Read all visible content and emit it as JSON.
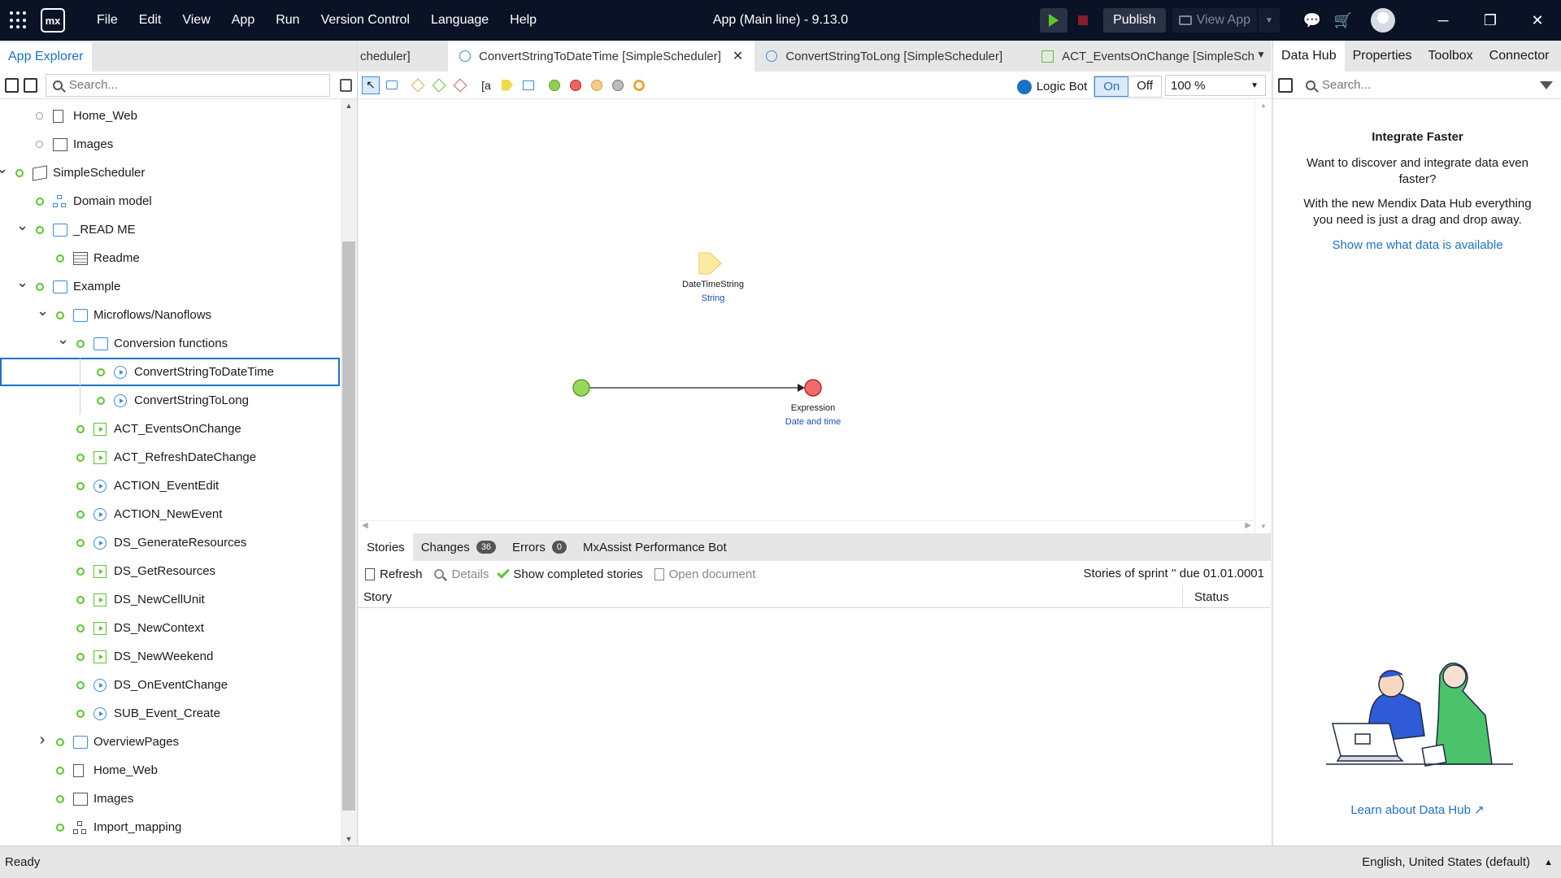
{
  "titlebar": {
    "menu": [
      "File",
      "Edit",
      "View",
      "App",
      "Run",
      "Version Control",
      "Language",
      "Help"
    ],
    "app_title": "App (Main line)  -  9.13.0",
    "publish": "Publish",
    "view_app": "View App",
    "logo": "mx"
  },
  "left_panel": {
    "tab": "App Explorer",
    "search_placeholder": "Search...",
    "tree": [
      {
        "label": "Home_Web",
        "icon": "page-icon",
        "depth": 2,
        "status": "grey"
      },
      {
        "label": "Images",
        "icon": "images-icon",
        "depth": 2,
        "status": "grey"
      },
      {
        "label": "SimpleScheduler",
        "icon": "module-icon",
        "depth": 1,
        "status": "green",
        "chevron": "down"
      },
      {
        "label": "Domain model",
        "icon": "domain-model-icon",
        "depth": 2,
        "status": "green"
      },
      {
        "label": "_READ ME",
        "icon": "folder-icon",
        "depth": 2,
        "status": "green",
        "chevron": "down"
      },
      {
        "label": "Readme",
        "icon": "readme-icon",
        "depth": 3,
        "status": "green"
      },
      {
        "label": "Example",
        "icon": "folder-icon",
        "depth": 2,
        "status": "green",
        "chevron": "down"
      },
      {
        "label": "Microflows/Nanoflows",
        "icon": "folder-icon",
        "depth": 3,
        "status": "green",
        "chevron": "down"
      },
      {
        "label": "Conversion functions",
        "icon": "folder-icon",
        "depth": 4,
        "status": "green",
        "chevron": "down"
      },
      {
        "label": "ConvertStringToDateTime",
        "icon": "microflow-icon",
        "depth": 5,
        "status": "green",
        "selected": true
      },
      {
        "label": "ConvertStringToLong",
        "icon": "microflow-icon",
        "depth": 5,
        "status": "green"
      },
      {
        "label": "ACT_EventsOnChange",
        "icon": "nanoflow-icon",
        "depth": 4,
        "status": "green"
      },
      {
        "label": "ACT_RefreshDateChange",
        "icon": "nanoflow-icon",
        "depth": 4,
        "status": "green"
      },
      {
        "label": "ACTION_EventEdit",
        "icon": "microflow-icon",
        "depth": 4,
        "status": "green"
      },
      {
        "label": "ACTION_NewEvent",
        "icon": "microflow-icon",
        "depth": 4,
        "status": "green"
      },
      {
        "label": "DS_GenerateResources",
        "icon": "microflow-icon",
        "depth": 4,
        "status": "green"
      },
      {
        "label": "DS_GetResources",
        "icon": "nanoflow-icon",
        "depth": 4,
        "status": "green"
      },
      {
        "label": "DS_NewCellUnit",
        "icon": "nanoflow-icon",
        "depth": 4,
        "status": "green"
      },
      {
        "label": "DS_NewContext",
        "icon": "nanoflow-icon",
        "depth": 4,
        "status": "green"
      },
      {
        "label": "DS_NewWeekend",
        "icon": "nanoflow-icon",
        "depth": 4,
        "status": "green"
      },
      {
        "label": "DS_OnEventChange",
        "icon": "microflow-icon",
        "depth": 4,
        "status": "green"
      },
      {
        "label": "SUB_Event_Create",
        "icon": "microflow-icon",
        "depth": 4,
        "status": "green"
      },
      {
        "label": "OverviewPages",
        "icon": "folder-icon",
        "depth": 3,
        "status": "green",
        "chevron": "right"
      },
      {
        "label": "Home_Web",
        "icon": "page-icon",
        "depth": 3,
        "status": "green"
      },
      {
        "label": "Images",
        "icon": "images-icon",
        "depth": 3,
        "status": "green"
      },
      {
        "label": "Import_mapping",
        "icon": "import-mapping-icon",
        "depth": 3,
        "status": "green"
      }
    ]
  },
  "doc_tabs": [
    {
      "label": "cheduler]",
      "icon": "none",
      "active": false
    },
    {
      "label": "ConvertStringToDateTime [SimpleScheduler]",
      "icon": "microflow-icon",
      "active": true
    },
    {
      "label": "ConvertStringToLong [SimpleScheduler]",
      "icon": "microflow-icon",
      "active": false
    },
    {
      "label": "ACT_EventsOnChange [SimpleSch",
      "icon": "nanoflow-icon",
      "active": false
    }
  ],
  "editor": {
    "logic_bot": "Logic Bot",
    "on": "On",
    "off": "Off",
    "zoom": "100 %"
  },
  "canvas": {
    "param_name": "DateTimeString",
    "param_type": "String",
    "end_label": "Expression",
    "end_type": "Date and time"
  },
  "bottom": {
    "tabs": [
      {
        "label": "Stories",
        "badge": null,
        "active": true
      },
      {
        "label": "Changes",
        "badge": "36",
        "active": false
      },
      {
        "label": "Errors",
        "badge": "0",
        "active": false
      },
      {
        "label": "MxAssist Performance Bot",
        "badge": null,
        "active": false
      }
    ],
    "refresh": "Refresh",
    "details": "Details",
    "show_completed": "Show completed stories",
    "open_document": "Open document",
    "sprint": "Stories of sprint '' due 01.01.0001",
    "col_story": "Story",
    "col_status": "Status"
  },
  "right_panel": {
    "tabs": [
      "Data Hub",
      "Properties",
      "Toolbox",
      "Connector"
    ],
    "search_placeholder": "Search...",
    "title": "Integrate Faster",
    "p1": "Want to discover and integrate data even faster?",
    "p2": "With the new Mendix Data Hub everything you need is just a drag and drop away.",
    "link": "Show me what data is available",
    "learn": "Learn about Data Hub"
  },
  "statusbar": {
    "status": "Ready",
    "language": "English, United States (default)"
  },
  "colors": {
    "accent": "#1a73c7",
    "success": "#5ac72d",
    "titlebar": "#0a1326"
  }
}
